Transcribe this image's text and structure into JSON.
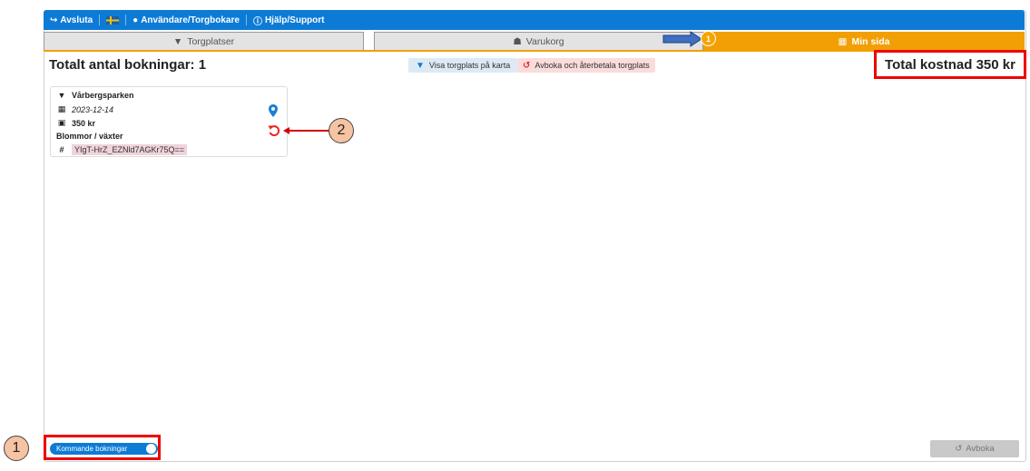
{
  "topbar": {
    "logout_label": "Avsluta",
    "user_label": "Användare/Torgbokare",
    "help_label": "Hjälp/Support"
  },
  "tabs": [
    {
      "label": "Torgplatser",
      "icon": "map-marker-icon"
    },
    {
      "label": "Varukorg",
      "icon": "basket-icon"
    },
    {
      "label": "Min sida",
      "icon": "calendar-icon"
    }
  ],
  "cart_badge": "1",
  "page_title": "Totalt antal bokningar: 1",
  "actions": {
    "map_label": "Visa torgplats på karta",
    "cancel_refund_label": "Avboka och återbetala torgplats"
  },
  "total_cost": "Total kostnad 350 kr",
  "booking": {
    "location": "Vårbergsparken",
    "date": "2023-12-14",
    "price": "350 kr",
    "category": "Blommor / växter",
    "code": "YIgT-HrZ_EZNld7AGKr75Q=="
  },
  "callouts": {
    "one": "1",
    "two": "2"
  },
  "toggle_label": "Kommande bokningar",
  "avboka_label": "Avboka",
  "colors": {
    "primary": "#0d7bd6",
    "accent": "#f29f05",
    "highlight": "#ee0000"
  }
}
